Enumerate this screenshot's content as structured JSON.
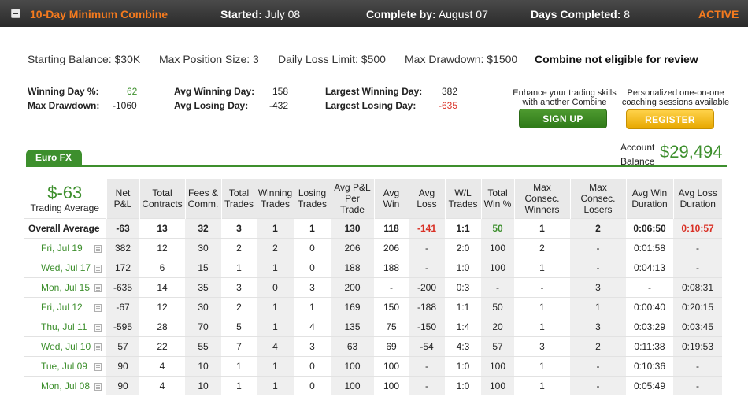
{
  "header": {
    "title": "10-Day Minimum Combine",
    "started_label": "Started:",
    "started_value": "July 08",
    "complete_label": "Complete by:",
    "complete_value": "August 07",
    "days_label": "Days Completed:",
    "days_value": "8",
    "status": "ACTIVE"
  },
  "summary": {
    "starting_balance": "Starting Balance: $30K",
    "max_position": "Max Position Size: 3",
    "daily_loss": "Daily Loss Limit: $500",
    "max_drawdown": "Max Drawdown: $1500",
    "eligibility": "Combine not eligible for review"
  },
  "stats": {
    "winning_day_pct_label": "Winning Day %:",
    "winning_day_pct": "62",
    "max_drawdown_label": "Max Drawdown:",
    "max_drawdown": "-1060",
    "avg_winning_day_label": "Avg Winning Day:",
    "avg_winning_day": "158",
    "avg_losing_day_label": "Avg Losing Day:",
    "avg_losing_day": "-432",
    "largest_winning_day_label": "Largest Winning Day:",
    "largest_winning_day": "382",
    "largest_losing_day_label": "Largest Losing Day:",
    "largest_losing_day": "-635"
  },
  "promo": {
    "signup_text_1": "Enhance your trading skills",
    "signup_text_2": "with another Combine",
    "signup_button": "SIGN UP",
    "register_text_1": "Personalized one-on-one",
    "register_text_2": "coaching sessions available",
    "register_button": "REGISTER"
  },
  "account": {
    "label_1": "Account",
    "label_2": "Balance",
    "value": "$29,494"
  },
  "tab": {
    "label": "Euro FX"
  },
  "table": {
    "trading_average_value": "$-63",
    "trading_average_label": "Trading Average",
    "headers": [
      "Net P&L",
      "Total Contracts",
      "Fees & Comm.",
      "Total Trades",
      "Winning Trades",
      "Losing Trades",
      "Avg P&L Per Trade",
      "Avg Win",
      "Avg Loss",
      "W/L Trades",
      "Total Win %",
      "Max Consec. Winners",
      "Max Consec. Losers",
      "Avg Win Duration",
      "Avg Loss Duration"
    ],
    "overall": {
      "label": "Overall Average",
      "cells": [
        "-63",
        "13",
        "32",
        "3",
        "1",
        "1",
        "130",
        "118",
        "-141",
        "1:1",
        "50",
        "1",
        "2",
        "0:06:50",
        "0:10:57"
      ]
    },
    "rows": [
      {
        "day": "Fri, Jul 19",
        "cells": [
          "382",
          "12",
          "30",
          "2",
          "2",
          "0",
          "206",
          "206",
          "-",
          "2:0",
          "100",
          "2",
          "-",
          "0:01:58",
          "-"
        ]
      },
      {
        "day": "Wed, Jul 17",
        "cells": [
          "172",
          "6",
          "15",
          "1",
          "1",
          "0",
          "188",
          "188",
          "-",
          "1:0",
          "100",
          "1",
          "-",
          "0:04:13",
          "-"
        ]
      },
      {
        "day": "Mon, Jul 15",
        "cells": [
          "-635",
          "14",
          "35",
          "3",
          "0",
          "3",
          "200",
          "-",
          "-200",
          "0:3",
          "-",
          "-",
          "3",
          "-",
          "0:08:31"
        ]
      },
      {
        "day": "Fri, Jul 12",
        "cells": [
          "-67",
          "12",
          "30",
          "2",
          "1",
          "1",
          "169",
          "150",
          "-188",
          "1:1",
          "50",
          "1",
          "1",
          "0:00:40",
          "0:20:15"
        ]
      },
      {
        "day": "Thu, Jul 11",
        "cells": [
          "-595",
          "28",
          "70",
          "5",
          "1",
          "4",
          "135",
          "75",
          "-150",
          "1:4",
          "20",
          "1",
          "3",
          "0:03:29",
          "0:03:45"
        ]
      },
      {
        "day": "Wed, Jul 10",
        "cells": [
          "57",
          "22",
          "55",
          "7",
          "4",
          "3",
          "63",
          "69",
          "-54",
          "4:3",
          "57",
          "3",
          "2",
          "0:11:38",
          "0:19:53"
        ]
      },
      {
        "day": "Tue, Jul 09",
        "cells": [
          "90",
          "4",
          "10",
          "1",
          "1",
          "0",
          "100",
          "100",
          "-",
          "1:0",
          "100",
          "1",
          "-",
          "0:10:36",
          "-"
        ]
      },
      {
        "day": "Mon, Jul 08",
        "cells": [
          "90",
          "4",
          "10",
          "1",
          "1",
          "0",
          "100",
          "100",
          "-",
          "1:0",
          "100",
          "1",
          "-",
          "0:05:49",
          "-"
        ]
      }
    ]
  }
}
